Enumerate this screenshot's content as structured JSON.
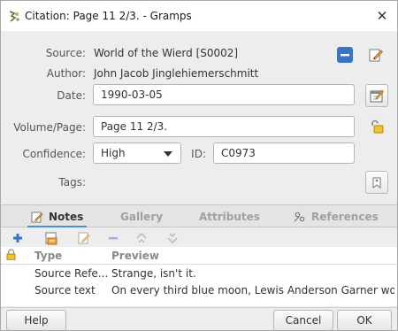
{
  "window": {
    "title": "Citation: Page 11 2/3. - Gramps",
    "close_glyph": "✕"
  },
  "form": {
    "source_label": "Source:",
    "source_value": "World of the Wierd [S0002]",
    "author_label": "Author:",
    "author_value": "John Jacob Jinglehiemerschmitt",
    "date_label": "Date:",
    "date_value": "1990-03-05",
    "volume_label": "Volume/Page:",
    "volume_value": "Page 11 2/3.",
    "confidence_label": "Confidence:",
    "confidence_value": "High",
    "id_label": "ID:",
    "id_value": "C0973",
    "tags_label": "Tags:"
  },
  "tabs": [
    {
      "label": "Notes",
      "active": true
    },
    {
      "label": "Gallery",
      "active": false
    },
    {
      "label": "Attributes",
      "active": false
    },
    {
      "label": "References",
      "active": false
    }
  ],
  "list": {
    "columns": [
      "Type",
      "Preview"
    ],
    "rows": [
      {
        "type": "Source Refe...",
        "preview": "Strange, isn't it."
      },
      {
        "type": "Source text",
        "preview": "On every third blue moon, Lewis Anderson Garner would ..."
      }
    ]
  },
  "buttons": {
    "help": "Help",
    "cancel": "Cancel",
    "ok": "OK"
  },
  "colors": {
    "accent": "#4a90d9",
    "remove_button": "#3a74c4",
    "window_bg": "#ededed"
  }
}
